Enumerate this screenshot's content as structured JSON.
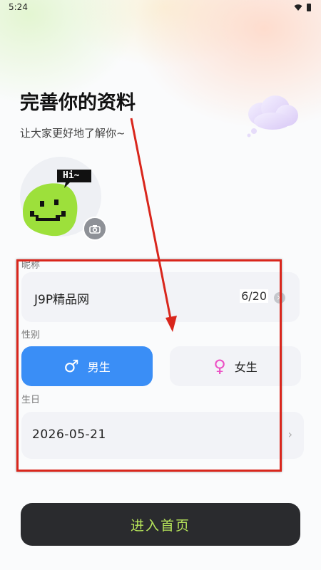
{
  "status_bar": {
    "time": "5:24",
    "icons": [
      "wifi-icon",
      "battery-icon"
    ]
  },
  "header": {
    "title": "完善你的资料",
    "subtitle": "让大家更好地了解你~"
  },
  "avatar": {
    "bubble_text": "Hi~",
    "camera_icon": "camera-icon"
  },
  "nickname": {
    "label": "昵称",
    "value": "J9P精品网",
    "count": "6/20",
    "clear_icon": "clear-icon"
  },
  "gender": {
    "label": "性别",
    "male_label": "男生",
    "female_label": "女生",
    "male_symbol": "♂",
    "female_symbol": "♀",
    "selected": "male"
  },
  "birthday": {
    "label": "生日",
    "value": "2026-05-21",
    "chevron": "›"
  },
  "enter_button": {
    "label": "进入首页"
  },
  "colors": {
    "accent_blue": "#3a8ef6",
    "female_pink": "#ec4fc4",
    "button_dark": "#2a2b2e",
    "button_text_green": "#b6e45a",
    "annotation_red": "#d9261c"
  }
}
